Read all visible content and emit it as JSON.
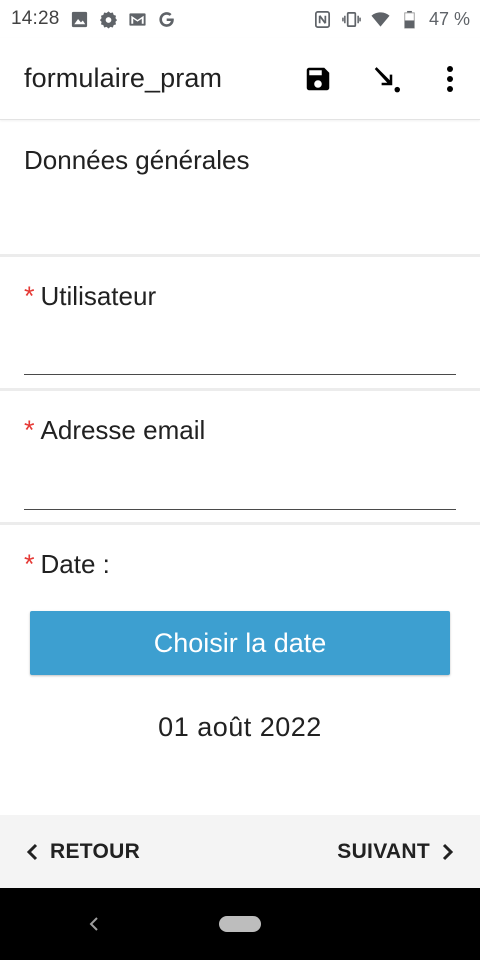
{
  "status_bar": {
    "time": "14:28",
    "left_icons": [
      "image-icon",
      "settings-icon",
      "gmail-icon",
      "google-icon"
    ],
    "right_icons": [
      "nfc-icon",
      "vibrate-icon",
      "wifi-icon",
      "battery-icon"
    ],
    "battery_percent": "47 %"
  },
  "app_bar": {
    "title": "formulaire_pram",
    "actions": [
      "save-icon",
      "send-arrow-icon",
      "more-vert-icon"
    ]
  },
  "form": {
    "section_title": "Données générales",
    "fields": [
      {
        "label": "Utilisateur",
        "required": "*",
        "value": "",
        "placeholder": ""
      },
      {
        "label": "Adresse email",
        "required": "*",
        "value": "",
        "placeholder": ""
      },
      {
        "label": "Date :",
        "required": "*"
      }
    ],
    "date_button_label": "Choisir la date",
    "date_value": "01 août 2022"
  },
  "bottom_nav": {
    "back_label": "RETOUR",
    "next_label": "SUIVANT"
  },
  "colors": {
    "accent": "#3d9fd0",
    "required": "#e53935",
    "nav_background": "#f4f4f4"
  }
}
